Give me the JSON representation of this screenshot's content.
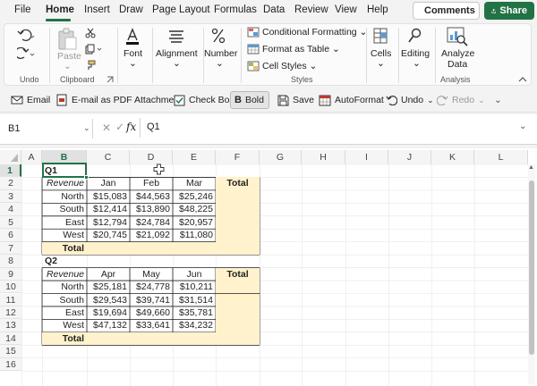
{
  "menu": {
    "tabs": [
      "File",
      "Home",
      "Insert",
      "Draw",
      "Page Layout",
      "Formulas",
      "Data",
      "Review",
      "View",
      "Help"
    ],
    "active": "Home",
    "comments_label": "Comments",
    "share_label": "Share"
  },
  "ribbon": {
    "undo_group": "Undo",
    "paste_label": "Paste",
    "clipboard_group": "Clipboard",
    "font_label": "Font",
    "alignment_label": "Alignment",
    "number_label": "Number",
    "conditional_formatting": "Conditional Formatting",
    "format_as_table": "Format as Table",
    "cell_styles": "Cell Styles",
    "styles_group": "Styles",
    "cells_label": "Cells",
    "editing_label": "Editing",
    "analyze_data_line1": "Analyze",
    "analyze_data_line2": "Data",
    "analysis_group": "Analysis"
  },
  "qat": {
    "email": "Email",
    "email_pdf": "E-mail as PDF Attachment",
    "check_box": "Check Box",
    "bold": "Bold",
    "save": "Save",
    "autoformat": "AutoFormat",
    "undo": "Undo",
    "redo": "Redo"
  },
  "formula_bar": {
    "name_box": "B1",
    "fx": "fx",
    "content": "Q1"
  },
  "grid": {
    "columns": [
      "A",
      "B",
      "C",
      "D",
      "E",
      "F",
      "G",
      "H",
      "I",
      "J",
      "K",
      "L"
    ],
    "rows": [
      "1",
      "2",
      "3",
      "4",
      "5",
      "6",
      "7",
      "8",
      "9",
      "10",
      "11",
      "12",
      "13",
      "14",
      "15",
      "16"
    ]
  },
  "q1": {
    "title": "Q1",
    "header": [
      "Revenue",
      "Jan",
      "Feb",
      "Mar",
      "Total"
    ],
    "rows": [
      [
        "North",
        "$15,083",
        "$44,563",
        "$25,246"
      ],
      [
        "South",
        "$12,414",
        "$13,890",
        "$48,225"
      ],
      [
        "East",
        "$12,794",
        "$24,784",
        "$20,957"
      ],
      [
        "West",
        "$20,745",
        "$21,092",
        "$11,080"
      ]
    ],
    "total_label": "Total"
  },
  "q2": {
    "title": "Q2",
    "header": [
      "Revenue",
      "Apr",
      "May",
      "Jun",
      "Total"
    ],
    "rows": [
      [
        "North",
        "$25,181",
        "$24,778",
        "$10,211"
      ],
      [
        "South",
        "$29,543",
        "$39,741",
        "$31,514"
      ],
      [
        "East",
        "$19,694",
        "$49,660",
        "$35,781"
      ],
      [
        "West",
        "$47,132",
        "$33,641",
        "$34,232"
      ]
    ],
    "total_label": "Total"
  },
  "colors": {
    "accent": "#217346",
    "total_fill": "#fff2cc"
  }
}
